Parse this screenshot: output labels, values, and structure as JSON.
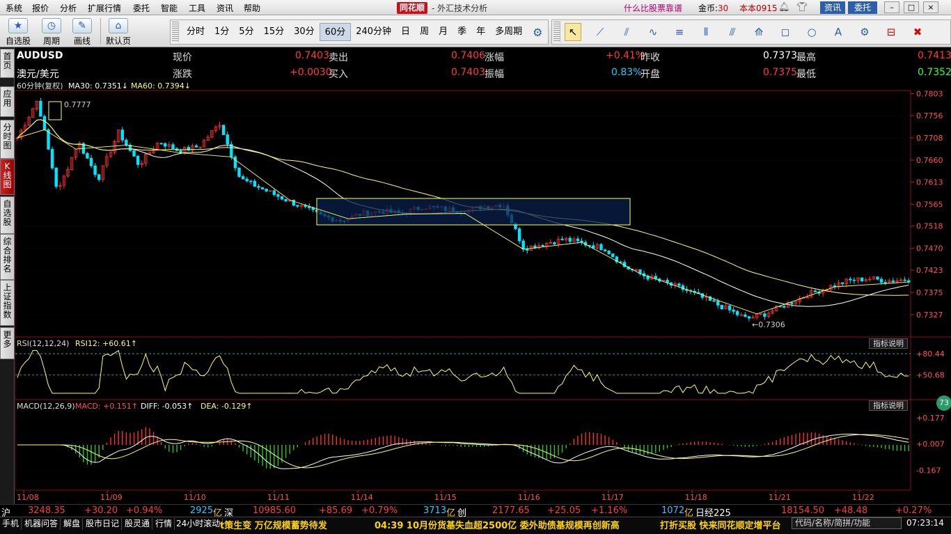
{
  "menu": {
    "items": [
      "系统",
      "报价",
      "分析",
      "扩展行情",
      "委托",
      "智能",
      "工具",
      "资讯",
      "帮助"
    ]
  },
  "brand": {
    "logo": "同花顺",
    "subtitle": "- 外汇技术分析"
  },
  "topbar": {
    "promo": "什么比股票靠谱",
    "coins_label": "金币:",
    "coins_value": "30",
    "user": "本本0915",
    "btn_zixun": "资讯",
    "btn_weituo": "委托",
    "win_min": "–",
    "win_max": "□",
    "win_close": "×"
  },
  "toolbar_groups": [
    {
      "label": "自选股",
      "icon": "★"
    },
    {
      "label": "周期",
      "icon": "◷"
    },
    {
      "label": "画线",
      "icon": "✎"
    },
    {
      "label": "默认页",
      "icon": "⌂"
    }
  ],
  "periods": [
    "分时",
    "1分",
    "5分",
    "15分",
    "30分",
    "60分",
    "240分钟",
    "日",
    "周",
    "月",
    "季",
    "年",
    "多周期"
  ],
  "active_period": "60分",
  "draw_tools": [
    "↖",
    "⟋",
    "⫽",
    "∿",
    "≡",
    "⦀",
    "⫻",
    "⟰",
    "◻",
    "○",
    "A",
    "⚙",
    "⊟",
    "✖"
  ],
  "left_tabs": [
    "首页",
    "应用",
    "分时图",
    "K线图",
    "自选股",
    "综合排名",
    "上证指数",
    "更多"
  ],
  "active_left_tab": "K线图",
  "quote": {
    "symbol": "AUDUSD",
    "name": "澳元/美元",
    "l_xianjia": "现价",
    "xianjia": "0.7403",
    "l_maichu": "卖出",
    "maichu": "0.7406",
    "l_zhangfu": "涨幅",
    "zhangfu": "+0.41%",
    "l_zuoshou": "昨收",
    "zuoshou": "0.7373",
    "l_zuigao": "最高",
    "zuigao": "0.7413",
    "l_zhangdie": "涨跌",
    "zhangdie": "+0.0030",
    "l_mairu": "买入",
    "mairu": "0.7403",
    "l_zhenfu": "振幅",
    "zhenfu": "0.83%",
    "l_kaipan": "开盘",
    "kaipan": "0.7375",
    "l_zuidi": "最低",
    "zuidi": "0.7352"
  },
  "main_legend": {
    "period": "60分钟(复权)",
    "ma30": "MA30: 0.7351",
    "ma60": "MA60: 0.7394"
  },
  "rsi_legend": {
    "name": "RSI(12,12,24)",
    "val": "RSI12: +60.61"
  },
  "macd_legend": {
    "name": "MACD(12,26,9)",
    "macd": "MACD: +0.151",
    "diff": "DIFF: -0.053",
    "dea": "DEA: -0.129"
  },
  "indicator_btn": "指标说明",
  "annotations": {
    "high": "0.7777",
    "low": "0.7306"
  },
  "badge": "73",
  "chart_data": {
    "type": "candlestick",
    "price_ylim": [
      0.7285,
      0.781
    ],
    "price_ticks": [
      "0.7803",
      "0.7756",
      "0.7708",
      "0.7660",
      "0.7613",
      "0.7565",
      "0.7518",
      "0.7470",
      "0.7423",
      "0.7375",
      "0.7327"
    ],
    "rsi_ticks": [
      "+80.44",
      "+50.68"
    ],
    "rsi_levels": [
      80.44,
      50.68
    ],
    "macd_ticks": [
      "+0.177",
      "+0.007",
      "-0.167"
    ],
    "x_labels": [
      "11/08",
      "11/09",
      "11/10",
      "11/11",
      "11/14",
      "11/15",
      "11/16",
      "11/17",
      "11/18",
      "11/21",
      "11/22"
    ],
    "trend_anchor_points": [
      [
        0.7708,
        0.779,
        0.759,
        0.77,
        0.762,
        0.772,
        0.765,
        0.77,
        0.768,
        0.769,
        0.774,
        0.762,
        0.76,
        0.758,
        0.756,
        0.754,
        0.753,
        0.7545,
        0.755,
        0.7545,
        0.756,
        0.7555,
        0.755,
        0.756,
        0.7565,
        0.747,
        0.748,
        0.749,
        0.748,
        0.747,
        0.743,
        0.741,
        0.7395,
        0.738,
        0.736,
        0.734,
        0.7318,
        0.733,
        0.735,
        0.737,
        0.7385,
        0.74,
        0.7405,
        0.74,
        0.7403
      ]
    ],
    "series": [
      {
        "name": "MA30",
        "color": "#ffffff"
      },
      {
        "name": "MA60",
        "color": "#ffff66"
      }
    ]
  },
  "ticker": {
    "sh_label": "沪",
    "sh_val": "3248.35",
    "sh_chg": "+30.20",
    "sh_pct": "+0.94%",
    "sh_amt": "2925",
    "sh_unit": "亿",
    "sz_label": "深",
    "sz_val": "10985.60",
    "sz_chg": "+85.69",
    "sz_pct": "+0.79%",
    "sz_amt": "3713",
    "sz_unit": "亿",
    "cy_label": "创",
    "cy_val": "2177.65",
    "cy_chg": "+25.05",
    "cy_pct": "+1.16%",
    "cy_amt": "1072",
    "cy_unit": "亿",
    "nk_label": "日经225",
    "nk_val": "18154.50",
    "nk_chg": "+48.48",
    "nk_pct": "+0.27%"
  },
  "status": {
    "tabs": [
      "手机",
      "机器问答",
      "解盘",
      "股市日记",
      "股灵通",
      "行情",
      "24小时滚动"
    ],
    "news1": "t策生变 万亿规模蓄势待发",
    "news2": "04:39 10月份货基失血超2500亿 委外助债基规模再创新高",
    "news3": "打折买股 快来同花顺定增平台",
    "search_placeholder": "代码/名称/简拼/功能",
    "clock": "07:23:14"
  },
  "colors": {
    "up": "#ff3030",
    "down": "#00e5ff",
    "ma_white": "#ffffff",
    "ma_yellow": "#ffff66",
    "box": "#0a1f4a"
  }
}
